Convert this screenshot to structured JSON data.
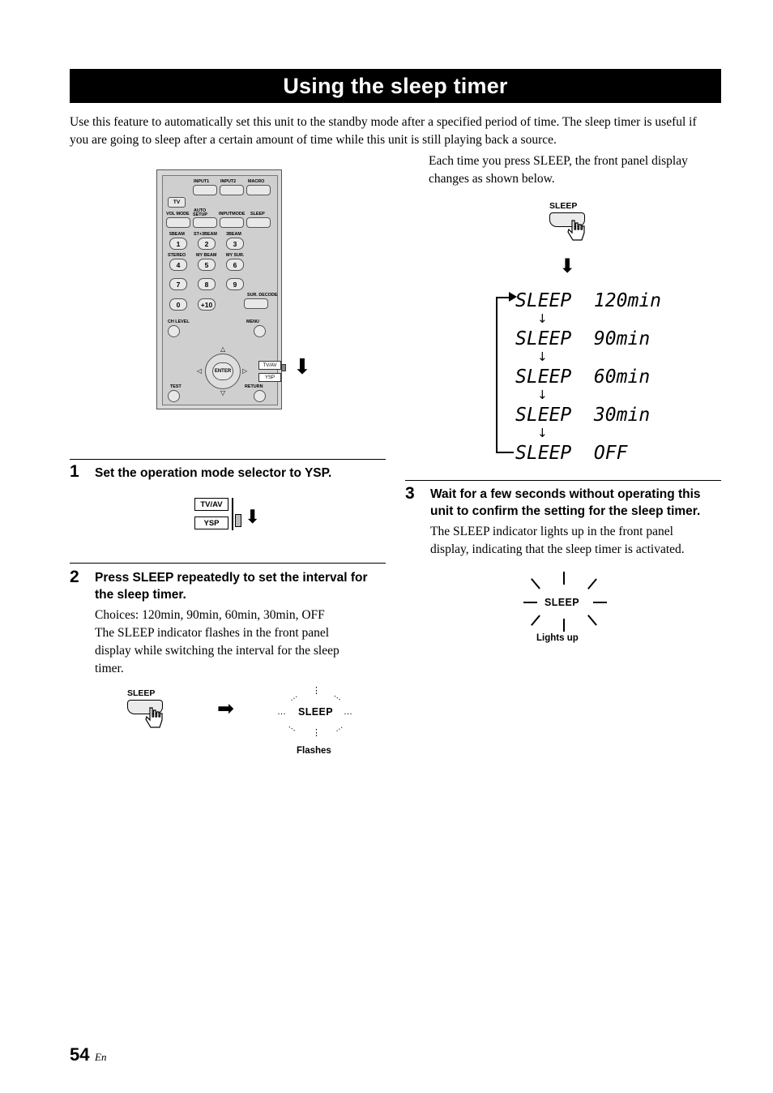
{
  "header": {
    "title": "Using the sleep timer"
  },
  "intro": "Use this feature to automatically set this unit to the standby mode after a specified period of time. The sleep timer is useful if you are going to sleep after a certain amount of time while this unit is still playing back a source.",
  "remote": {
    "labels": {
      "input1": "INPUT1",
      "input2": "INPUT2",
      "macro": "MACRO",
      "tv": "TV",
      "vol_mode": "VOL MODE",
      "auto_setup": "AUTO SETUP",
      "input_mode": "INPUTMODE",
      "sleep": "SLEEP",
      "beam5": "5BEAM",
      "beam_st3": "ST+3BEAM",
      "beam3": "3BEAM",
      "stereo": "STEREO",
      "my_beam": "MY BEAM",
      "my_sur": "MY SUR.",
      "sur_decode": "SUR. DECODE",
      "ch_level": "CH LEVEL",
      "menu": "MENU",
      "test": "TEST",
      "return": "RETURN",
      "enter": "ENTER",
      "tvav": "TV/AV",
      "ysp": "YSP",
      "plus10": "+10",
      "keys": [
        "1",
        "2",
        "3",
        "4",
        "5",
        "6",
        "7",
        "8",
        "9",
        "0"
      ]
    }
  },
  "steps": [
    {
      "num": "1",
      "head": "Set the operation mode selector to YSP.",
      "body": "",
      "figure": {
        "tvav": "TV/AV",
        "ysp": "YSP"
      }
    },
    {
      "num": "2",
      "head": "Press SLEEP repeatedly to set the interval for the sleep timer.",
      "body_lines": [
        "Choices: 120min, 90min, 60min, 30min, OFF",
        "The SLEEP indicator flashes in the front panel",
        "display while switching the interval for the sleep",
        "timer."
      ],
      "figure": {
        "button_label": "SLEEP",
        "indicator_label": "SLEEP",
        "caption": "Flashes"
      }
    },
    {
      "num": "3",
      "head": "Wait for a few seconds without operating this unit to confirm the setting for the sleep timer.",
      "body_lines": [
        "The SLEEP indicator lights up in the front panel",
        "display, indicating that the sleep timer is activated."
      ],
      "figure": {
        "indicator_label": "SLEEP",
        "caption": "Lights up"
      }
    }
  ],
  "right_top": {
    "text_lines": [
      "Each time you press SLEEP, the front panel display",
      "changes as shown below."
    ],
    "button_label": "SLEEP"
  },
  "cycle": {
    "items": [
      "SLEEP  120min",
      "SLEEP  90min",
      "SLEEP  60min",
      "SLEEP  30min",
      "SLEEP  OFF"
    ],
    "arrow": "↓"
  },
  "footer": {
    "page": "54",
    "lang": "En"
  }
}
